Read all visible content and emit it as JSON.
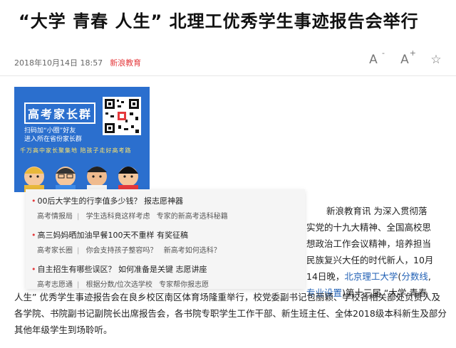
{
  "article": {
    "title": "“大学 青春 人生” 北理工优秀学生事迹报告会举行",
    "date": "2018年10月14日 18:57",
    "source": "新浪教育"
  },
  "tools": {
    "font_decrease_glyph": "A",
    "font_decrease_sub": "-",
    "font_increase_glyph": "A",
    "font_increase_sub": "+",
    "favorite_glyph": "☆"
  },
  "ad": {
    "title": "高考家长群",
    "line1": "扫码加“小圈”好友",
    "line2": "进入所在省份家长群",
    "tagline": "千万高中家长聚集地  陪孩子走好高考路"
  },
  "popup": {
    "items": [
      {
        "headline": "00后大学生的行李值多少钱？ 报志愿神器",
        "links": [
          "高考情报局",
          "学生选科竟这样考虑",
          "专家的新高考选科秘籍"
        ]
      },
      {
        "headline": "高三妈妈晒加油早餐100天不重样 有奖征稿",
        "links": [
          "高考家长圈",
          "你会支持孩子整容吗？",
          "新高考如何选科？"
        ]
      },
      {
        "headline": "自主招生有哪些误区？ 如何准备是关键 志愿讲座",
        "links": [
          "高考志愿通",
          "根据分数/位次选学校",
          "专家帮你报志愿"
        ]
      }
    ]
  },
  "body": {
    "lines_right": [
      "新浪教育讯 为深入贯彻落",
      "实党的十九大精神、全国高校思",
      "想政治工作会议精神，培养担当",
      "民族复兴大任的时代新人，10月",
      "14日晚，"
    ],
    "link_school": "北京理工大学",
    "paren_open": "(",
    "link_score": "分数线",
    "comma": ",",
    "link_major": "专业设置",
    "after_major": ")第十三届 “大学 青春",
    "full_text": "人生” 优秀学生事迹报告会在良乡校区南区体育场隆重举行，校党委副书记包丽颖、学校各相关部处负责人及各学院、书院副书记副院长出席报告会，各书院专职学生工作干部、新生班主任、全体2018级本科新生及部分其他年级学生到场聆听。"
  }
}
